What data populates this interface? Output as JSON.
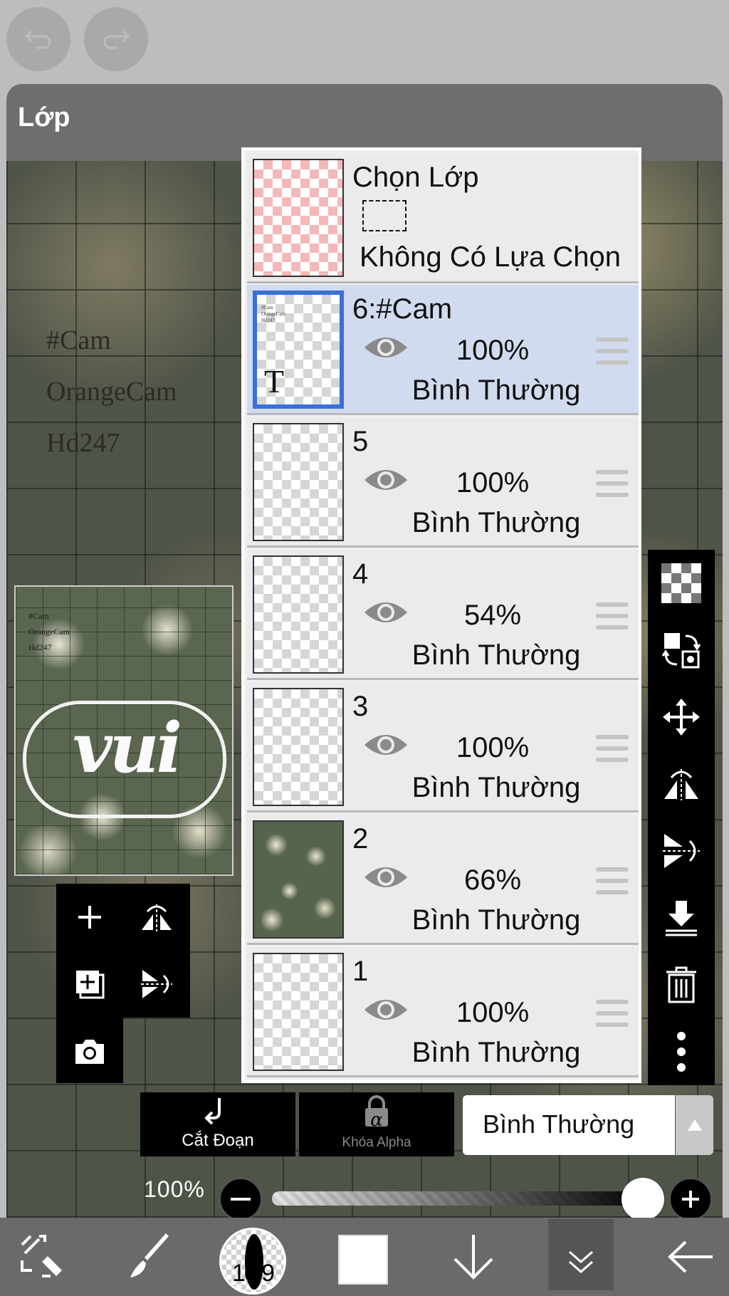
{
  "topbar": {
    "undo_icon": "undo-icon",
    "redo_icon": "redo-icon"
  },
  "panel": {
    "title": "Lớp",
    "canvas_text": [
      "#Cam",
      "OrangeCam",
      "Hd247"
    ],
    "preview_text": [
      "#Cam",
      "OrangeCam",
      "Hd247"
    ],
    "preview_word": "vui"
  },
  "selection_layer": {
    "label": "Chọn Lớp",
    "status": "Không Có Lựa Chọn"
  },
  "layers": [
    {
      "name": "6:#Cam",
      "opacity": "100%",
      "blend": "Bình Thường",
      "selected": true
    },
    {
      "name": "5",
      "opacity": "100%",
      "blend": "Bình Thường"
    },
    {
      "name": "4",
      "opacity": "54%",
      "blend": "Bình Thường"
    },
    {
      "name": "3",
      "opacity": "100%",
      "blend": "Bình Thường"
    },
    {
      "name": "2",
      "opacity": "66%",
      "blend": "Bình Thường"
    },
    {
      "name": "1",
      "opacity": "100%",
      "blend": "Bình Thường"
    }
  ],
  "layer_text_thumb": {
    "glyph": "T",
    "tiny_lines": [
      "#Cam",
      "OrangeCam",
      "Hd247"
    ]
  },
  "left_tools": [
    "add-layer-icon",
    "flip-horizontal-icon",
    "duplicate-layer-icon",
    "flip-vertical-icon",
    "camera-icon"
  ],
  "right_tools": [
    "transparency-icon",
    "swap-layers-icon",
    "move-icon",
    "flip-horizontal-icon",
    "flip-vertical-icon",
    "merge-down-icon",
    "trash-icon",
    "more-icon"
  ],
  "bottom_controls": {
    "clip_label": "Cắt Đoạn",
    "alpha_label": "Khóa Alpha",
    "alpha_glyph": "α",
    "blend_mode": "Bình Thường",
    "opacity_label": "100%",
    "opacity_value": 1.0
  },
  "bottom_bar": {
    "brush_size": "10.9",
    "color": "#ffffff",
    "icons": [
      "transform-icon",
      "brush-icon",
      "brush-size-icon",
      "color-icon",
      "download-icon",
      "layers-icon",
      "back-icon"
    ]
  },
  "colors": {
    "selected_row": "#d1dbef",
    "selected_border": "#3a6fd8",
    "panel": "#6e6e6e"
  }
}
